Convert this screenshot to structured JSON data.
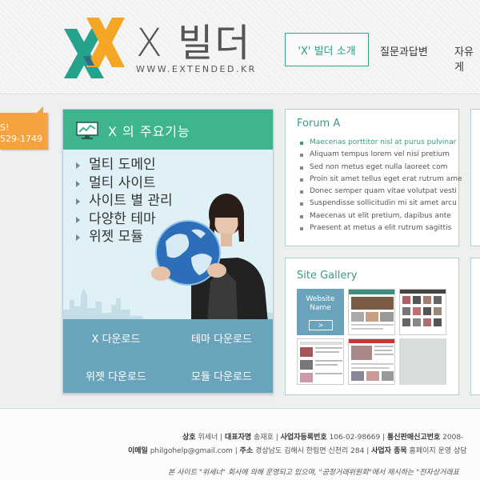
{
  "header": {
    "logo_title": "X 빌더",
    "logo_url": "WWW.EXTENDED.KR",
    "nav": [
      {
        "label": "'X' 빌더 소개"
      },
      {
        "label": "질문과답변"
      },
      {
        "label": "자유게"
      }
    ]
  },
  "phone_tag": {
    "line1": "S!",
    "line2": "529-1749"
  },
  "features": {
    "title": "X 의 주요기능",
    "items": [
      "멀티 도메인",
      "멀티 사이트",
      "사이트 별 관리",
      "다양한 테마",
      "위젯 모듈"
    ],
    "downloads": [
      "X 다운로드",
      "테마 다운로드",
      "위젯 다운로드",
      "모듈 다운로드"
    ]
  },
  "forum": {
    "title": "Forum A",
    "items": [
      "Maecenas porttitor nisl at purus pulvinar",
      "Aliquam tempus lorem vel nisi pretium",
      "Sed non metus eget nulla laoreet com",
      "Proin sit amet tellus eget erat rutrum ame",
      "Donec semper quam vitae volutpat vesti",
      "Suspendisse sollicitudin mi sit amet arcu",
      "Maecenas ut elit pretium, dapibus ante",
      "Praesent at metus a elit rutrum sagittis"
    ]
  },
  "gallery": {
    "title": "Site Gallery",
    "website_line1": "Website",
    "website_line2": "Name",
    "go_label": ">"
  },
  "footer": {
    "line1": {
      "company_label": "상호",
      "company": "위세너",
      "ceo_label": "대표자명",
      "ceo": "송재호",
      "biz_label": "사업자등록번호",
      "biz": "106-02-98669",
      "mail_order_label": "통신판매신고번호",
      "mail_order": "2008-"
    },
    "line2": {
      "email_label": "이메일",
      "email": "philgohelp@gmail.com",
      "addr_label": "주소",
      "addr": "경상남도 김해시 한림면 신천리 284",
      "type_label": "사업자 종목",
      "type": "홈페이지 운영 상담"
    },
    "notice": "본 사이트 \"위세너\" 회사에 의해 운영되고 있으며, \"공정거래위원회\"에서 제시하는 \"전자상거래표"
  },
  "colors": {
    "accent_green": "#3fb58f",
    "accent_teal_text": "#2e9985",
    "download_blue": "#6aa4bc",
    "phone_orange": "#f4a340"
  }
}
